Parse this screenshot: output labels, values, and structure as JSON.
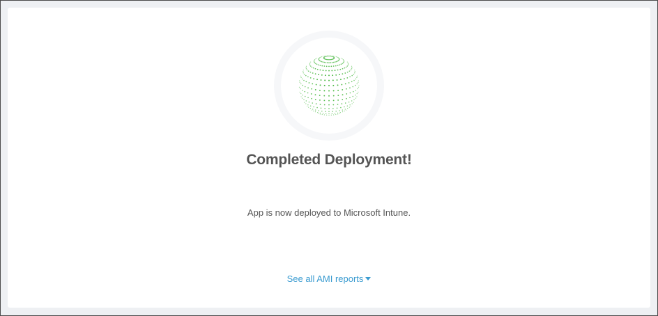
{
  "status": {
    "title": "Completed Deployment!",
    "message": "App is now deployed to Microsoft Intune.",
    "reports_link": "See all AMI reports"
  },
  "icons": {
    "globe": "dotted-globe-icon",
    "caret": "caret-down-icon"
  },
  "colors": {
    "globe_green": "#4cb944",
    "link_blue": "#3a9bd0",
    "text_gray": "#555555",
    "frame_bg": "#eef0f3"
  }
}
